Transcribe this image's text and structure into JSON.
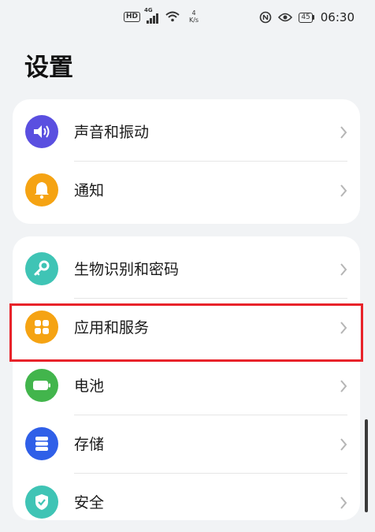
{
  "status_bar": {
    "hd_badge": "HD",
    "network_type": "4G",
    "speed_value": "4",
    "speed_unit": "K/s",
    "battery_level": "45",
    "time": "06:30",
    "icons": [
      "hd-icon",
      "signal-icon",
      "wifi-icon",
      "nfc-icon",
      "eye-comfort-icon",
      "battery-icon"
    ]
  },
  "page_title": "设置",
  "groups": [
    {
      "items": [
        {
          "label": "声音和振动",
          "icon": "speaker-icon",
          "color": "#5a4fe0"
        },
        {
          "label": "通知",
          "icon": "bell-icon",
          "color": "#f5a313"
        }
      ]
    },
    {
      "items": [
        {
          "label": "生物识别和密码",
          "icon": "key-icon",
          "color": "#3fc4b5"
        },
        {
          "label": "应用和服务",
          "icon": "apps-grid-icon",
          "color": "#f5a313",
          "highlighted": true
        },
        {
          "label": "电池",
          "icon": "battery-icon",
          "color": "#42b54c"
        },
        {
          "label": "存储",
          "icon": "storage-icon",
          "color": "#2f5fe8"
        },
        {
          "label": "安全",
          "icon": "shield-icon",
          "color": "#3fc4b5"
        }
      ]
    }
  ],
  "highlight_color": "#e8232a"
}
